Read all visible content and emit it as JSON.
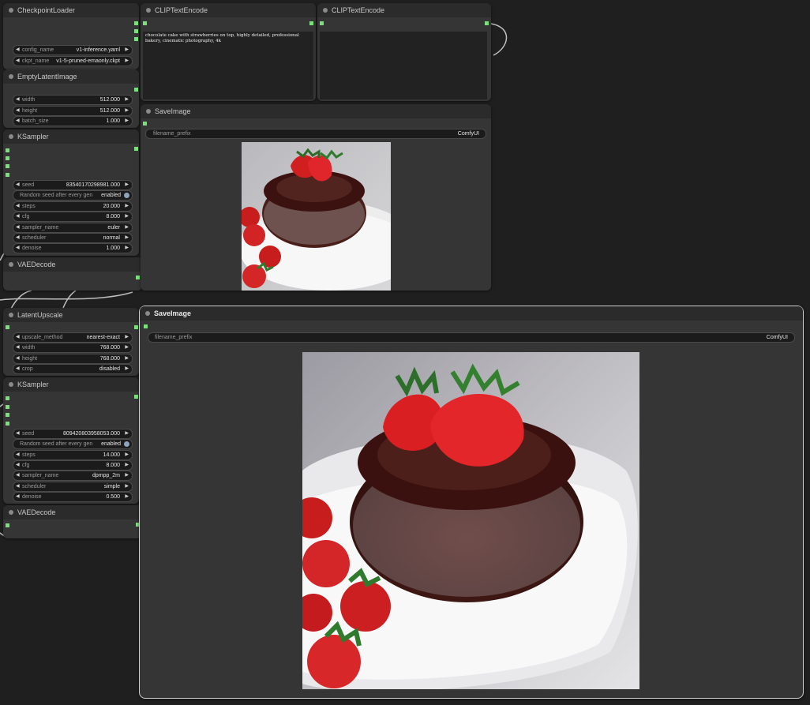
{
  "colors": {
    "canvas": "#1f1f1f",
    "node_bg": "#353535",
    "title_bg": "#2b2b2b",
    "port": "#7be07b",
    "selected_border": "#cfcfcf"
  },
  "nodes": {
    "checkpoint_loader": {
      "title": "CheckpointLoader",
      "widgets": [
        {
          "label": "config_name",
          "value": "v1-inference.yaml"
        },
        {
          "label": "ckpt_name",
          "value": "v1-5-pruned-emaonly.ckpt"
        }
      ]
    },
    "empty_latent": {
      "title": "EmptyLatentImage",
      "widgets": [
        {
          "label": "width",
          "value": "512.000"
        },
        {
          "label": "height",
          "value": "512.000"
        },
        {
          "label": "batch_size",
          "value": "1.000"
        }
      ]
    },
    "ksampler1": {
      "title": "KSampler",
      "widgets": [
        {
          "label": "seed",
          "value": "83540170298981.000"
        },
        {
          "label": "Random seed after every gen",
          "value": "enabled"
        },
        {
          "label": "steps",
          "value": "20.000"
        },
        {
          "label": "cfg",
          "value": "8.000"
        },
        {
          "label": "sampler_name",
          "value": "euler"
        },
        {
          "label": "scheduler",
          "value": "normal"
        },
        {
          "label": "denoise",
          "value": "1.000"
        }
      ]
    },
    "vae_decode1": {
      "title": "VAEDecode"
    },
    "latent_upscale": {
      "title": "LatentUpscale",
      "widgets": [
        {
          "label": "upscale_method",
          "value": "nearest-exact"
        },
        {
          "label": "width",
          "value": "768.000"
        },
        {
          "label": "height",
          "value": "768.000"
        },
        {
          "label": "crop",
          "value": "disabled"
        }
      ]
    },
    "ksampler2": {
      "title": "KSampler",
      "widgets": [
        {
          "label": "seed",
          "value": "809420803958053.000"
        },
        {
          "label": "Random seed after every gen",
          "value": "enabled"
        },
        {
          "label": "steps",
          "value": "14.000"
        },
        {
          "label": "cfg",
          "value": "8.000"
        },
        {
          "label": "sampler_name",
          "value": "dpmpp_2m"
        },
        {
          "label": "scheduler",
          "value": "simple"
        },
        {
          "label": "denoise",
          "value": "0.500"
        }
      ]
    },
    "vae_decode2": {
      "title": "VAEDecode"
    },
    "clip_text1": {
      "title": "CLIPTextEncode",
      "text": "chocolate cake with strawberries on top, highly detailed, professional bakery, cinematic photography, 4k"
    },
    "clip_text2": {
      "title": "CLIPTextEncode",
      "text": ""
    },
    "save_image1": {
      "title": "SaveImage",
      "widgets": [
        {
          "label": "filename_prefix",
          "value": "ComfyUI"
        }
      ],
      "image": "chocolate-cake-with-strawberries"
    },
    "save_image2": {
      "title": "SaveImage",
      "widgets": [
        {
          "label": "filename_prefix",
          "value": "ComfyUI"
        }
      ],
      "image": "chocolate-cake-with-strawberries"
    }
  }
}
